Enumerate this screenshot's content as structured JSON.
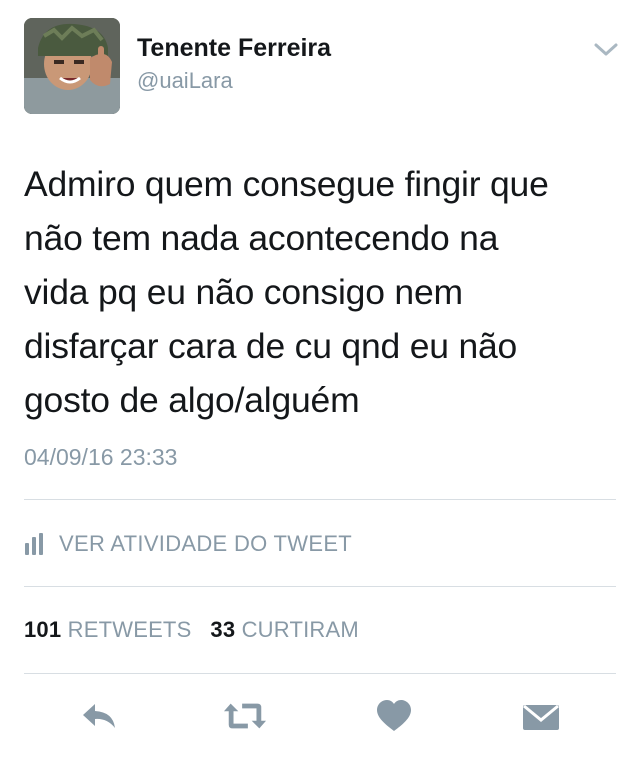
{
  "author": {
    "display_name": "Tenente Ferreira",
    "handle": "@uaiLara",
    "avatar_icon": "profile-photo"
  },
  "tweet": {
    "lines": [
      "Admiro quem consegue fingir que",
      "não tem nada acontecendo na",
      "vida pq eu não consigo nem",
      "disfarçar cara de cu qnd eu não",
      "gosto de algo/alguém"
    ],
    "timestamp": "04/09/16 23:33"
  },
  "activity": {
    "label": "VER ATIVIDADE DO TWEET",
    "icon": "bar-chart-icon"
  },
  "stats": {
    "retweets_count": "101",
    "retweets_label": "RETWEETS",
    "likes_count": "33",
    "likes_label": "CURTIRAM"
  },
  "actions": [
    {
      "name": "reply",
      "icon": "reply-icon"
    },
    {
      "name": "retweet",
      "icon": "retweet-icon"
    },
    {
      "name": "like",
      "icon": "heart-icon"
    },
    {
      "name": "share",
      "icon": "envelope-icon"
    }
  ],
  "colors": {
    "text": "#14171a",
    "secondary": "#8899a6",
    "divider": "#d8dee3",
    "icon": "#8899a6"
  }
}
